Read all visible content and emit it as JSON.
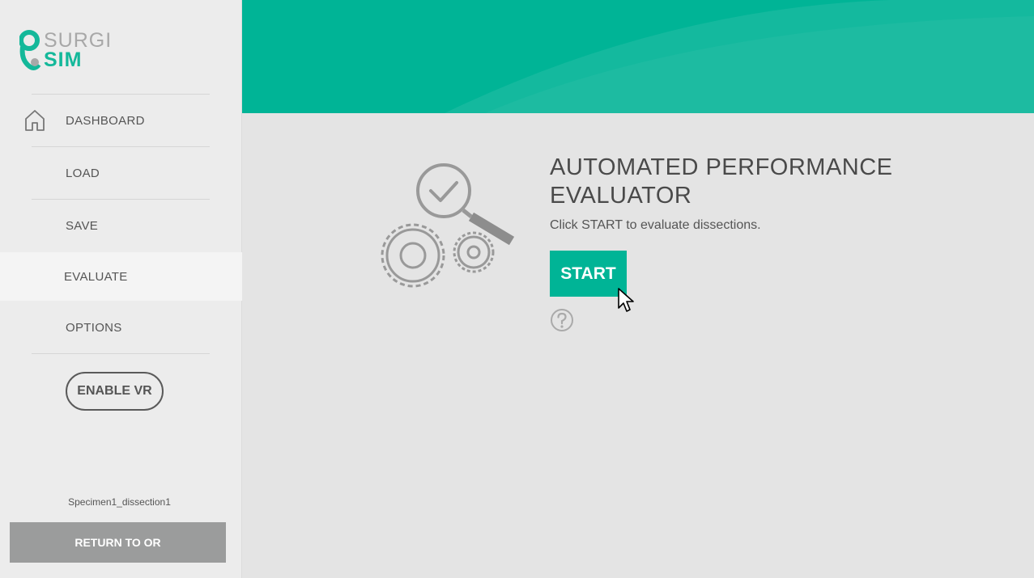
{
  "app": {
    "logo_top": "SURGI",
    "logo_bottom": "SIM"
  },
  "colors": {
    "accent": "#00b496",
    "sidebar_bg": "#ececec",
    "main_bg": "#e4e4e4",
    "return_button_bg": "#9b9c9c"
  },
  "sidebar": {
    "items": [
      {
        "label": "DASHBOARD",
        "icon": "home-icon"
      },
      {
        "label": "LOAD"
      },
      {
        "label": "SAVE"
      },
      {
        "label": "EVALUATE",
        "active": true
      },
      {
        "label": "OPTIONS"
      }
    ],
    "vr_button": "ENABLE VR",
    "specimen": "Specimen1_dissection1",
    "return_button": "RETURN TO OR"
  },
  "main": {
    "illustration": "gears-magnifier-check-icon",
    "title": "AUTOMATED PERFORMANCE EVALUATOR",
    "description": "Click START to evaluate dissections.",
    "start_button": "START",
    "help_icon": "question-circle-icon"
  }
}
